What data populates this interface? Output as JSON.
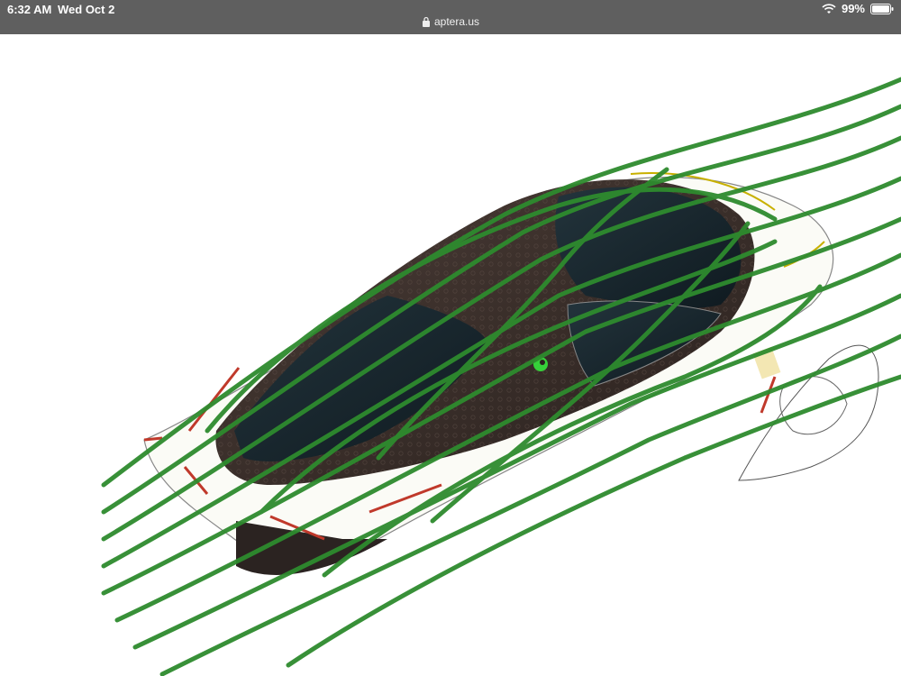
{
  "status_bar": {
    "time": "6:32 AM",
    "date": "Wed Oct 2",
    "battery": "99%",
    "url": "aptera.us"
  },
  "page": {
    "image": {
      "icon_name": "aptera-airflow-render",
      "streamline_color": "#2e8b2e",
      "body_color": "#3a2e2a",
      "logo_color": "#36d13a"
    }
  }
}
